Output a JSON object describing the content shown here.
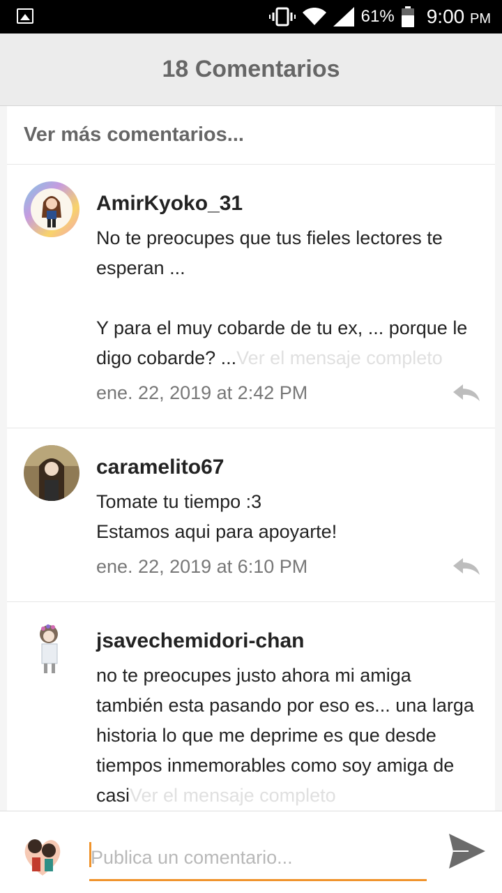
{
  "status_bar": {
    "battery": "61%",
    "time": "9:00",
    "ampm": "PM"
  },
  "header": {
    "title": "18 Comentarios"
  },
  "more_comments": "Ver más comentarios...",
  "comments": [
    {
      "username": "AmirKyoko_31",
      "text": "No te preocupes que tus fieles lectores te esperan ...\n\nY para el muy cobarde de tu ex, ... porque le digo cobarde? ...",
      "see_more": "Ver el mensaje completo",
      "timestamp": "ene. 22, 2019 at 2:42 PM"
    },
    {
      "username": "caramelito67",
      "text": "Tomate tu tiempo :3\nEstamos aqui para apoyarte!",
      "see_more": "",
      "timestamp": "ene. 22, 2019 at 6:10 PM"
    },
    {
      "username": "jsavechemidori-chan",
      "text": "no te preocupes justo ahora mi amiga también esta pasando por eso es... una larga historia lo que me deprime es que desde tiempos inmemorables como soy amiga de casi",
      "see_more": "Ver el mensaje completo",
      "timestamp": ""
    }
  ],
  "input": {
    "placeholder": "Publica un comentario..."
  },
  "colors": {
    "accent": "#f0932b",
    "header_bg": "#ececec"
  }
}
